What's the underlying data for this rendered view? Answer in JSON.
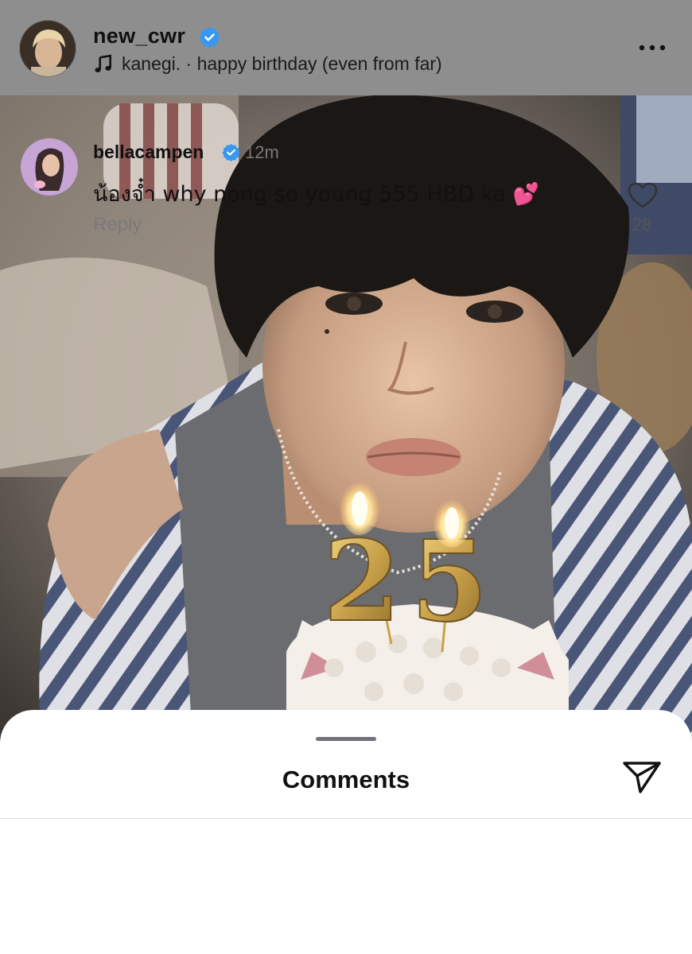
{
  "header": {
    "username": "new_cwr",
    "song": "kanegi. · happy birthday (even from far)",
    "verified_icon": "verified-badge-icon",
    "music_icon": "music-note-icon",
    "more_icon": "more-horizontal-icon"
  },
  "photo": {
    "candle_digits": "25"
  },
  "comments_sheet": {
    "title": "Comments",
    "share_icon": "send-icon",
    "comments": [
      {
        "username": "bellacampen",
        "time": "12m",
        "text": "น้องจ๋ำ why nong so young 555 HBD ka 💕",
        "reply_label": "Reply",
        "like_count": "28"
      }
    ]
  },
  "colors": {
    "verified_blue": "#3897f0",
    "header_bg": "#8e8e8e",
    "sheet_bg": "#ffffff"
  }
}
